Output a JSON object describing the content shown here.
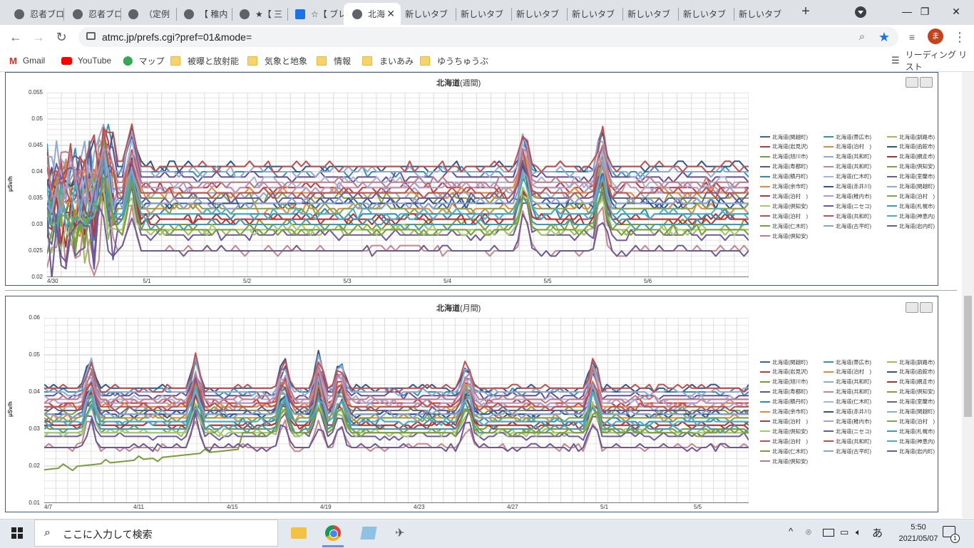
{
  "browser": {
    "tabs": [
      {
        "label": "忍者ブロ",
        "active": false
      },
      {
        "label": "忍者ブロ",
        "active": false
      },
      {
        "label": "（定例",
        "active": false
      },
      {
        "label": "【 稚内",
        "active": false
      },
      {
        "label": "★【 三",
        "active": false
      },
      {
        "label": "☆【 ブレ",
        "active": false
      },
      {
        "label": "北海",
        "active": true
      },
      {
        "label": "新しいタブ",
        "active": false
      },
      {
        "label": "新しいタブ",
        "active": false
      },
      {
        "label": "新しいタブ",
        "active": false
      },
      {
        "label": "新しいタブ",
        "active": false
      },
      {
        "label": "新しいタブ",
        "active": false
      },
      {
        "label": "新しいタブ",
        "active": false
      },
      {
        "label": "新しいタブ",
        "active": false
      }
    ],
    "url": "atmc.jp/prefs.cgi?pref=01&mode=",
    "profile_initial": "ま",
    "bookmarks": [
      "Gmail",
      "YouTube",
      "マップ",
      "被曝と放射能",
      "気象と地象",
      "情報",
      "まいあみ",
      "ゆうちゅうぶ"
    ],
    "reading_list": "リーディング リスト"
  },
  "weekly": {
    "title_main": "北海道",
    "title_sub": "(週間)",
    "y_axis_name": "μSv/h",
    "y_ticks": [
      "0.055",
      "0.05",
      "0.045",
      "0.04",
      "0.035",
      "0.03",
      "0.025",
      "0.02"
    ],
    "x_ticks": [
      "4/30",
      "5/1",
      "5/2",
      "5/3",
      "5/4",
      "5/5",
      "5/6"
    ]
  },
  "monthly": {
    "title_main": "北海道",
    "title_sub": "(月間)",
    "y_axis_name": "μSv/h",
    "y_ticks": [
      "0.06",
      "0.05",
      "0.04",
      "0.03",
      "0.02",
      "0.01"
    ],
    "x_ticks": [
      "4/7",
      "4/11",
      "4/15",
      "4/19",
      "4/23",
      "4/27",
      "5/1",
      "5/5"
    ]
  },
  "legend": [
    {
      "label": "北海道(関越町)",
      "color": "#3a62a6"
    },
    {
      "label": "北海道(帯広市)",
      "color": "#3691b6"
    },
    {
      "label": "北海道(釧路市)",
      "color": "#9bbd5e"
    },
    {
      "label": "北海道(岩見沢)",
      "color": "#c0393b"
    },
    {
      "label": "北海道(泊村　)",
      "color": "#e8893a"
    },
    {
      "label": "北海道(函館市)",
      "color": "#2f568c"
    },
    {
      "label": "北海道(旭川市)",
      "color": "#7a9b3a"
    },
    {
      "label": "北海道(共和町)",
      "color": "#93a9cf"
    },
    {
      "label": "北海道(網走市)",
      "color": "#a93235"
    },
    {
      "label": "北海道(寿都町)",
      "color": "#6a4e94"
    },
    {
      "label": "北海道(共和町)",
      "color": "#c6868a"
    },
    {
      "label": "北海道(倶知安)",
      "color": "#80a23c"
    },
    {
      "label": "北海道(積丹町)",
      "color": "#2f8bb0"
    },
    {
      "label": "北海道(仁木町)",
      "color": "#a5b5d8"
    },
    {
      "label": "北海道(室蘭市)",
      "color": "#6f5a9b"
    },
    {
      "label": "北海道(余市町)",
      "color": "#e48b3b"
    },
    {
      "label": "北海道(赤井川)",
      "color": "#30558e"
    },
    {
      "label": "北海道(関越町)",
      "color": "#92a8d0"
    },
    {
      "label": "北海道(泊村　)",
      "color": "#b33a3a"
    },
    {
      "label": "北海道(稚内市)",
      "color": "#b59ac9"
    },
    {
      "label": "北海道(泊村　)",
      "color": "#85a14a"
    },
    {
      "label": "北海道(倶知安)",
      "color": "#a2c870"
    },
    {
      "label": "北海道(ニセコ)",
      "color": "#6b5a9b"
    },
    {
      "label": "北海道(札幌市)",
      "color": "#3f9bb5"
    },
    {
      "label": "北海道(泊村　)",
      "color": "#c0504d"
    },
    {
      "label": "北海道(共和町)",
      "color": "#c0504d"
    },
    {
      "label": "北海道(神恵内)",
      "color": "#4aacc6"
    },
    {
      "label": "北海道(仁木町)",
      "color": "#7b9c3c"
    },
    {
      "label": "北海道(古平町)",
      "color": "#8ba2cd"
    },
    {
      "label": "北海道(岩内町)",
      "color": "#6b5a95"
    },
    {
      "label": "北海道(倶知安)",
      "color": "#c07a86"
    }
  ],
  "taskbar": {
    "search_placeholder": "ここに入力して検索",
    "time": "5:50",
    "date": "2021/05/07",
    "ime": "あ",
    "notifications": "1"
  }
}
